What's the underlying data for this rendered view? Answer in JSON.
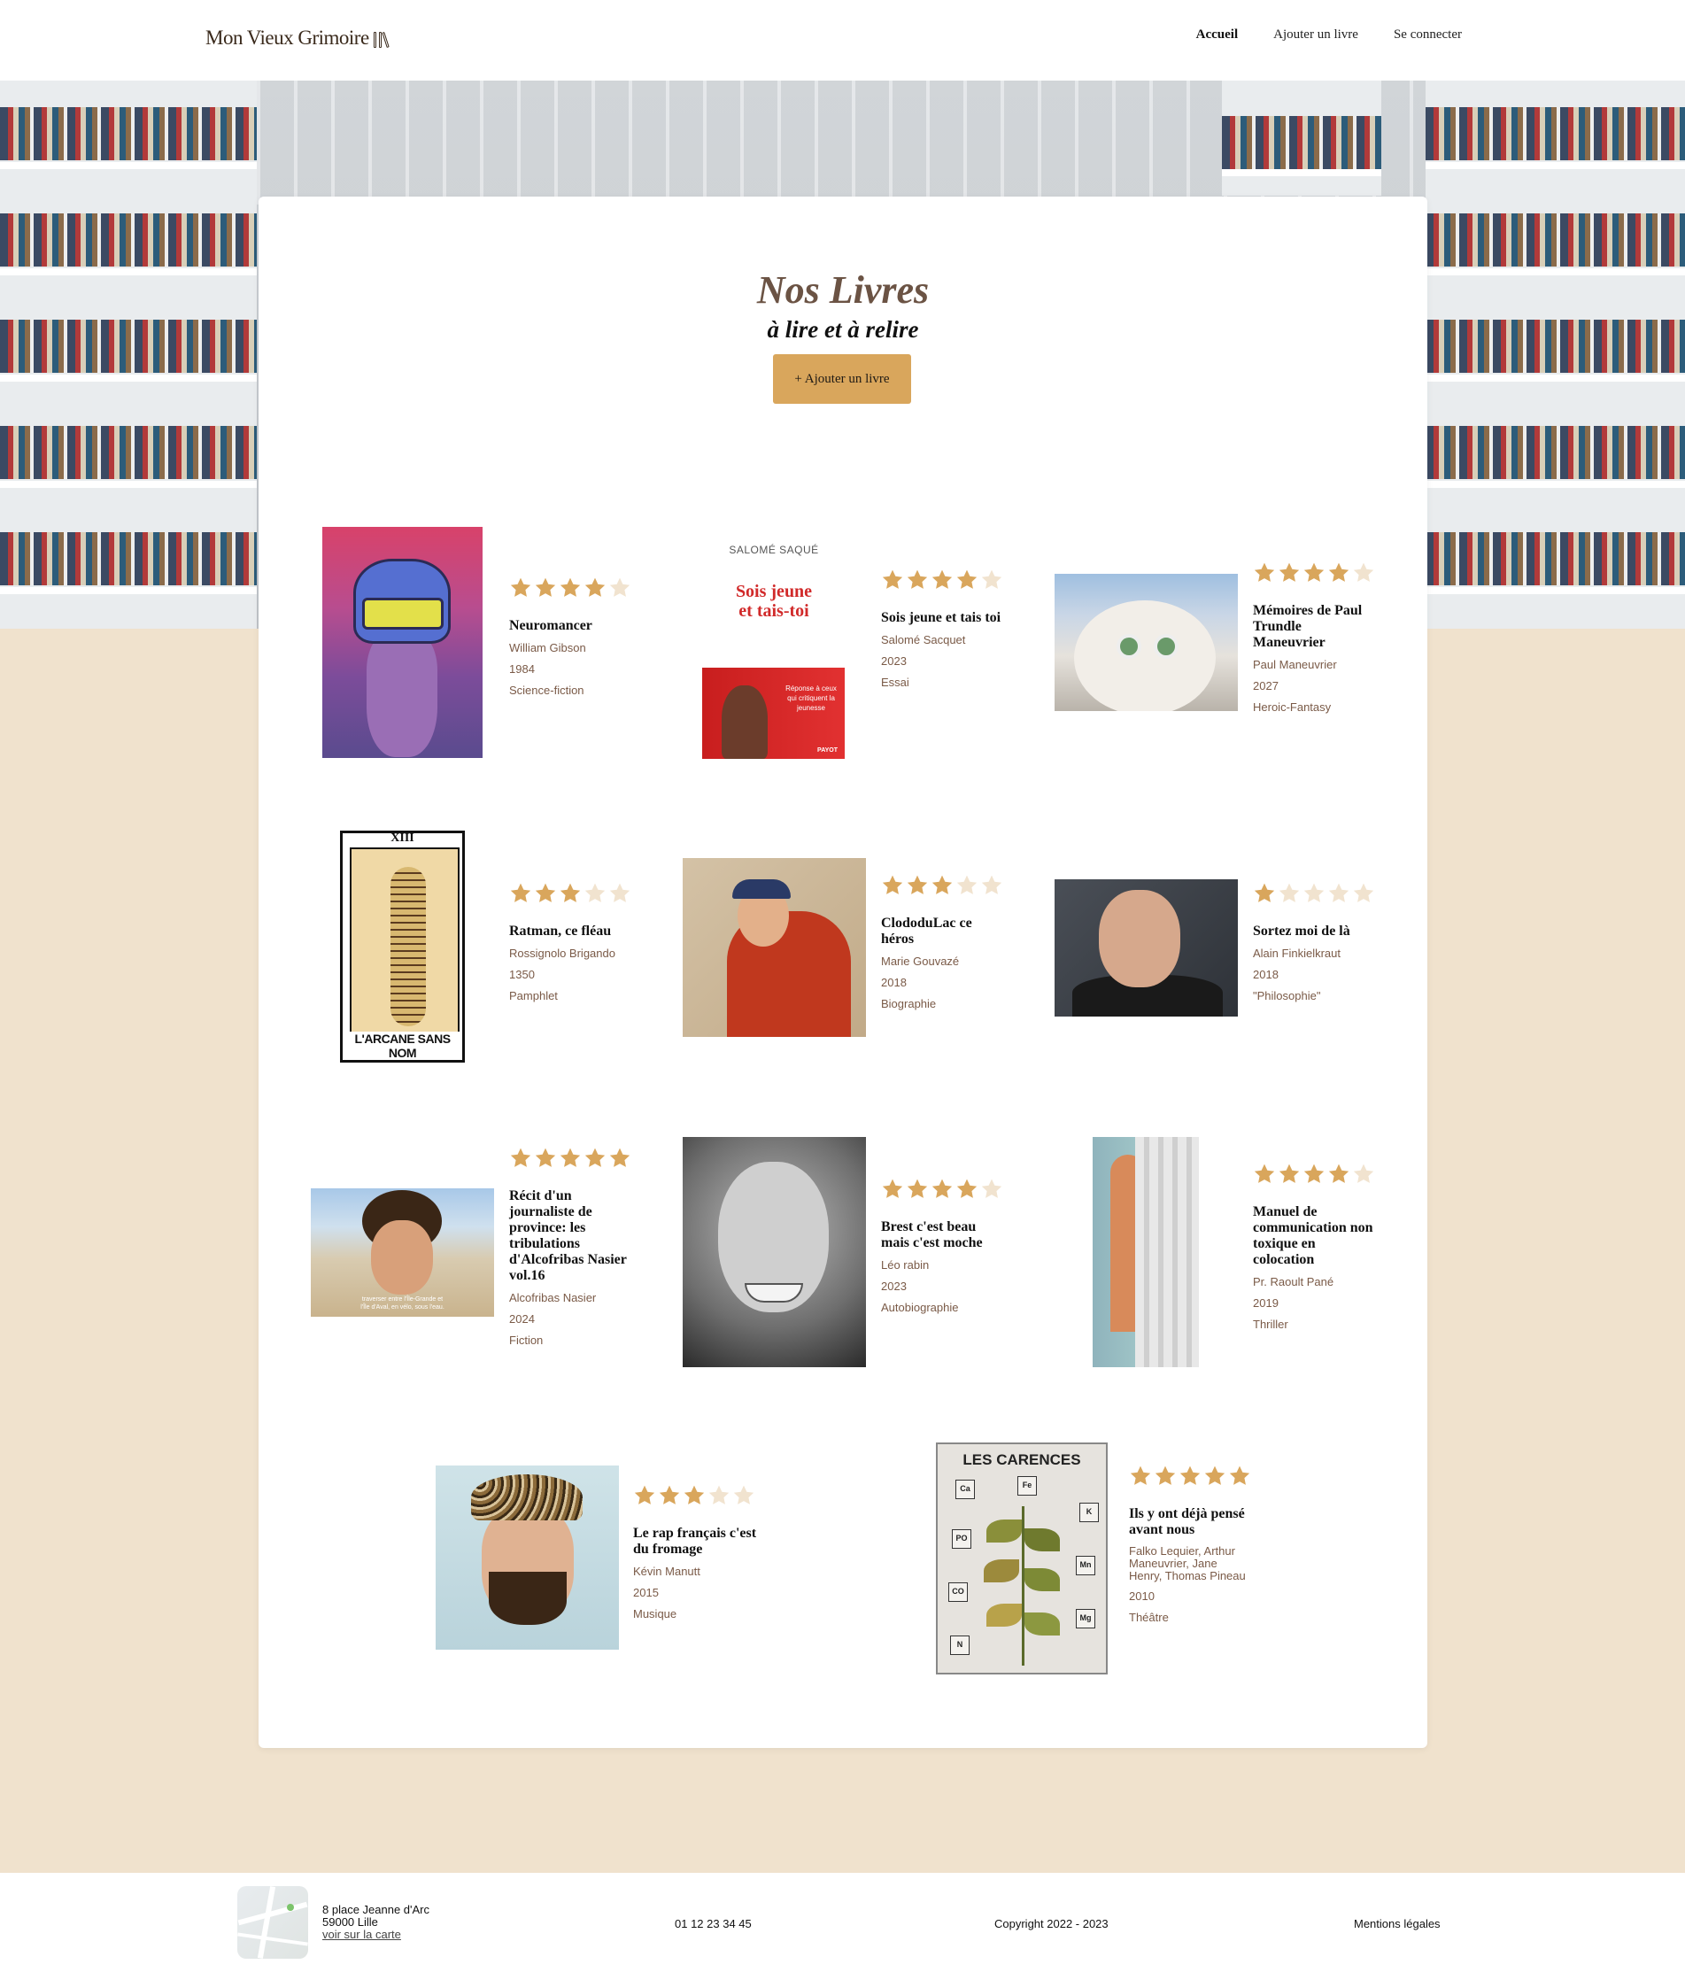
{
  "header": {
    "logo": "Mon Vieux Grimoire",
    "nav": [
      {
        "label": "Accueil",
        "active": true
      },
      {
        "label": "Ajouter un livre",
        "active": false
      },
      {
        "label": "Se connecter",
        "active": false
      }
    ]
  },
  "main": {
    "title": "Nos Livres",
    "subtitle": "à lire et à relire",
    "add_button": "+ Ajouter un livre"
  },
  "books": [
    {
      "title": "Neuromancer",
      "author": "William Gibson",
      "year": "1984",
      "genre": "Science-fiction",
      "rating": 4,
      "cover_icon": "cyberpunk-head-cover"
    },
    {
      "title": "Sois jeune et tais toi",
      "author": "Salomé Sacquet",
      "year": "2023",
      "genre": "Essai",
      "rating": 4,
      "cover_icon": "red-book-cover",
      "cover_text": {
        "author": "SALOMÉ SAQUÉ",
        "title_line1": "Sois jeune",
        "title_line2": "et tais-toi",
        "blurb": "Réponse à ceux qui critiquent la jeunesse",
        "publisher": "PAYOT"
      }
    },
    {
      "title": "Mémoires de Paul Trundle Maneuvrier",
      "author": "Paul Maneuvrier",
      "year": "2027",
      "genre": "Heroic-Fantasy",
      "rating": 4,
      "cover_icon": "cat-photo-cover"
    },
    {
      "title": "Ratman, ce fléau",
      "author": "Rossignolo Brigando",
      "year": "1350",
      "genre": "Pamphlet",
      "rating": 3,
      "cover_icon": "tarot-card-cover",
      "cover_text": {
        "number": "XIII",
        "label": "L'ARCANE SANS NOM"
      }
    },
    {
      "title": "ClododuLac ce héros",
      "author": "Marie Gouvazé",
      "year": "2018",
      "genre": "Biographie",
      "rating": 3,
      "cover_icon": "bagpipe-painting-cover"
    },
    {
      "title": "Sortez moi de là",
      "author": "Alain Finkielkraut",
      "year": "2018",
      "genre": "\"Philosophie\"",
      "rating": 1,
      "cover_icon": "portrait-photo-cover"
    },
    {
      "title": "Récit d'un journaliste de province: les tribulations d'Alcofribas Nasier vol.16",
      "author": "Alcofribas Nasier",
      "year": "2024",
      "genre": "Fiction",
      "rating": 5,
      "cover_icon": "beach-selfie-cover",
      "cover_text": {
        "subtitle_line1": "traverser entre l'Île-Grande et",
        "subtitle_line2": "l'Île d'Aval, en vélo, sous l'eau."
      }
    },
    {
      "title": "Brest c'est beau mais c'est moche",
      "author": "Léo rabin",
      "year": "2023",
      "genre": "Autobiographie",
      "rating": 4,
      "cover_icon": "bw-portrait-cover"
    },
    {
      "title": "Manuel de communication non toxique en colocation",
      "author": "Pr. Raoult Pané",
      "year": "2019",
      "genre": "Thriller",
      "rating": 4,
      "cover_icon": "curtain-photo-cover"
    },
    {
      "title": "Le rap français c'est du fromage",
      "author": "Kévin Manutt",
      "year": "2015",
      "genre": "Musique",
      "rating": 3,
      "cover_icon": "selfie-cap-cover"
    },
    {
      "title": "Ils y ont déjà pensé avant nous",
      "author": "Falko Lequier, Arthur Maneuvrier, Jane Henry, Thomas Pineau",
      "year": "2010",
      "genre": "Théâtre",
      "rating": 5,
      "cover_icon": "leaf-poster-cover",
      "cover_text": {
        "heading": "LES CARENCES",
        "elements": [
          "Ca",
          "Fe",
          "K",
          "PO",
          "CO",
          "Mn",
          "N",
          "Mg"
        ]
      }
    }
  ],
  "footer": {
    "address_line1": "8 place Jeanne d'Arc",
    "address_line2": "59000 Lille",
    "map_link": "voir sur la carte",
    "phone": "01 12 23 34 45",
    "copyright": "Copyright 2022 - 2023",
    "legal": "Mentions légales",
    "map_icon": "map-thumbnail-icon"
  },
  "colors": {
    "accent": "#d9a65c",
    "page_background": "#f0e2cd",
    "title_brown": "#6b5344",
    "meta_brown": "#7a5a47",
    "star_empty": "#f1e3cf"
  }
}
